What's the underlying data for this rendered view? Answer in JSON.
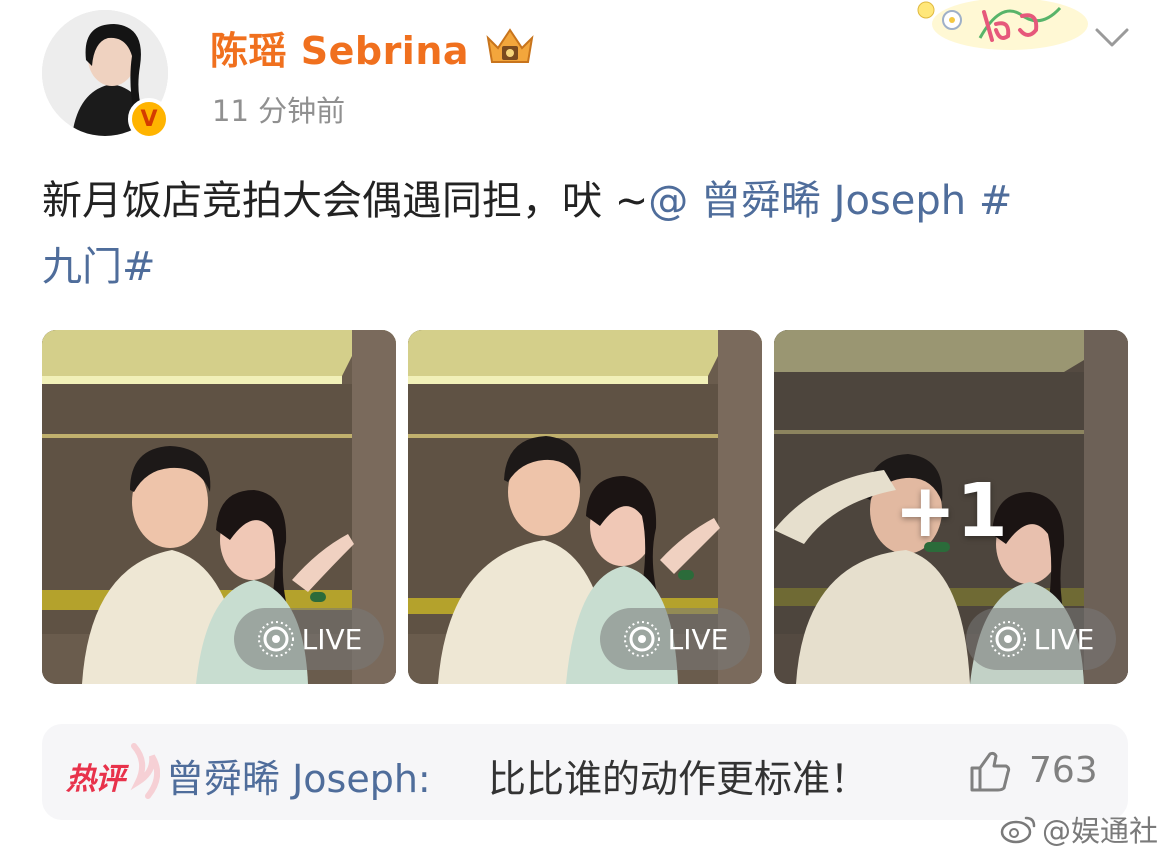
{
  "post": {
    "username": "陈瑶 Sebrina",
    "timestamp": "11 分钟前",
    "verified_badge": "V",
    "text": "新月饭店竞拍大会偶遇同担，吠 ~",
    "mention": "@ 曾舜晞 Joseph",
    "hashtag": "#九门#"
  },
  "photos": [
    {
      "live_label": "LIVE"
    },
    {
      "live_label": "LIVE"
    },
    {
      "live_label": "LIVE",
      "more_count": "+1"
    }
  ],
  "hot_comment": {
    "badge": "热评",
    "author": "曾舜晞 Joseph:",
    "text": "比比谁的动作更标准！",
    "likes": "763"
  },
  "watermark": "@娱通社",
  "icons": {
    "avatar": "avatar",
    "verified": "verified-badge-icon",
    "crown": "crown-badge-icon",
    "vlog": "vlog-sticker-icon",
    "menu": "chevron-down-icon",
    "live": "live-photo-icon",
    "like": "thumbs-up-icon",
    "weibo": "weibo-logo-icon"
  },
  "colors": {
    "username": "#f0701e",
    "link": "#4f6d9b",
    "hot_badge": "#e8324b",
    "comment_bg": "#f6f6f8"
  }
}
